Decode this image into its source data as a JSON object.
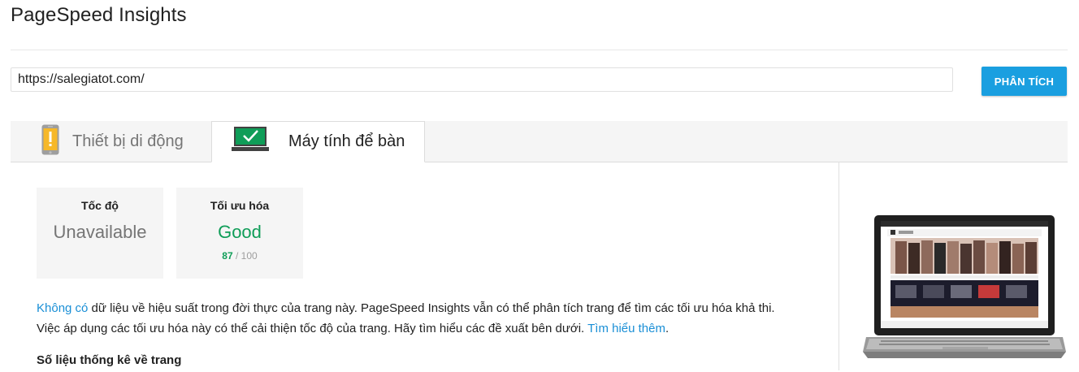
{
  "app": {
    "title": "PageSpeed Insights"
  },
  "search": {
    "url_value": "https://salegiatot.com/",
    "analyze_label": "PHÂN TÍCH"
  },
  "tabs": [
    {
      "label": "Thiết bị di động",
      "icon": "phone-warning-icon",
      "active": false
    },
    {
      "label": "Máy tính để bàn",
      "icon": "monitor-check-icon",
      "active": true
    }
  ],
  "scores": {
    "speed": {
      "title": "Tốc độ",
      "value": "Unavailable"
    },
    "optimization": {
      "title": "Tối ưu hóa",
      "value": "Good",
      "score": "87",
      "max": "/ 100"
    }
  },
  "description": {
    "link1": "Không có",
    "text1": " dữ liệu về hiệu suất trong đời thực của trang này. PageSpeed Insights vẫn có thể phân tích trang để tìm các tối ưu hóa khả thi.",
    "text2": "Việc áp dụng các tối ưu hóa này có thể cải thiện tốc độ của trang. Hãy tìm hiểu các đề xuất bên dưới. ",
    "link2": "Tìm hiểu thêm",
    "text3": "."
  },
  "stats": {
    "heading": "Số liệu thống kê về trang"
  },
  "colors": {
    "accent": "#1a9fe0",
    "good": "#0f9d58",
    "link": "#1a8fd6",
    "warning": "#f6b829"
  }
}
